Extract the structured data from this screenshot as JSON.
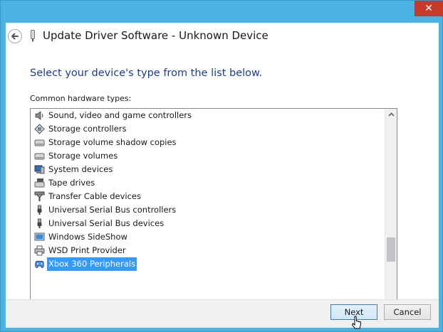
{
  "window": {
    "title": "Update Driver Software - Unknown Device",
    "close_glyph": "✕"
  },
  "main": {
    "instruction": "Select your device's type from the list below.",
    "list_label": "Common hardware types:",
    "items": [
      {
        "label": "Sound, video and game controllers",
        "icon": "speaker-icon"
      },
      {
        "label": "Storage controllers",
        "icon": "storage-controller-icon"
      },
      {
        "label": "Storage volume shadow copies",
        "icon": "drive-icon"
      },
      {
        "label": "Storage volumes",
        "icon": "drive-icon"
      },
      {
        "label": "System devices",
        "icon": "computer-icon"
      },
      {
        "label": "Tape drives",
        "icon": "tape-drive-icon"
      },
      {
        "label": "Transfer Cable devices",
        "icon": "transfer-cable-icon"
      },
      {
        "label": "Universal Serial Bus controllers",
        "icon": "usb-icon"
      },
      {
        "label": "Universal Serial Bus devices",
        "icon": "usb-icon"
      },
      {
        "label": "Windows SideShow",
        "icon": "sideshow-icon"
      },
      {
        "label": "WSD Print Provider",
        "icon": "printer-icon"
      },
      {
        "label": "Xbox 360 Peripherals",
        "icon": "gamepad-icon",
        "selected": true
      }
    ]
  },
  "footer": {
    "next_label": "Next",
    "cancel_label": "Cancel"
  }
}
